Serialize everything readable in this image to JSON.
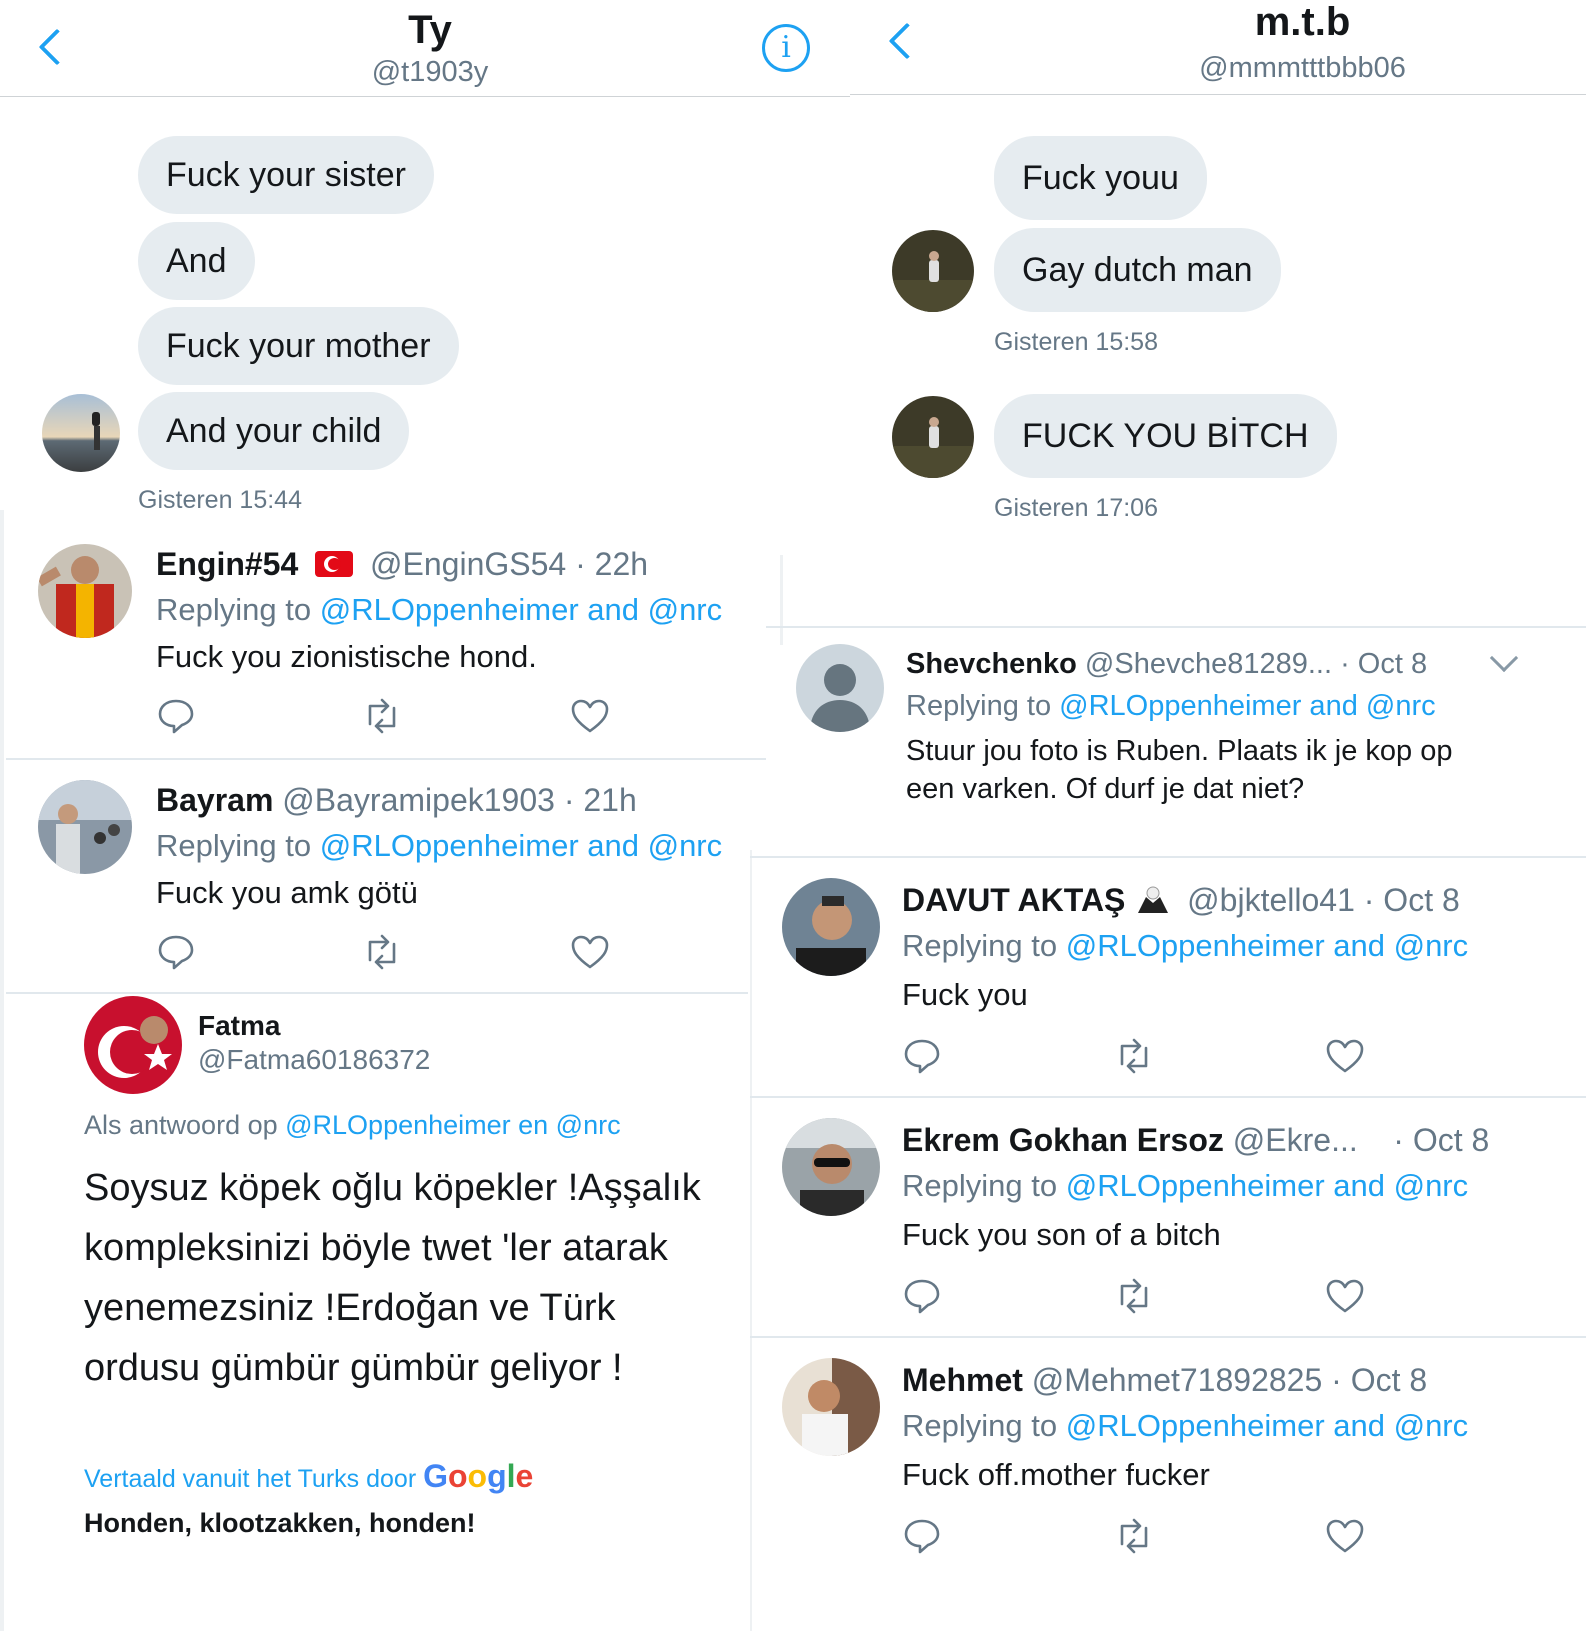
{
  "left_dm": {
    "name": "Ty",
    "handle": "@t1903y",
    "messages": [
      "Fuck your sister",
      "And",
      "Fuck your mother",
      "And your child"
    ],
    "timestamp": "Gisteren 15:44"
  },
  "right_dm": {
    "name": "m.t.b",
    "handle": "@mmmtttbbb06",
    "messages": [
      "Fuck youu",
      "Gay dutch man",
      "FUCK YOU BİTCH"
    ],
    "timestamps": [
      "Gisteren 15:58",
      "Gisteren 17:06"
    ]
  },
  "left_tweets": [
    {
      "name": "Engin#54",
      "flag": "turkish-flag",
      "meta": "@EnginGS54 · 22h",
      "reply_prefix": "Replying to ",
      "reply_targets": "@RLOppenheimer and @nrc",
      "text": "Fuck you zionistische hond."
    },
    {
      "name": "Bayram",
      "meta": "@Bayramipek1903 · 21h",
      "reply_prefix": "Replying to ",
      "reply_targets": "@RLOppenheimer and @nrc",
      "text": "Fuck you amk götü"
    }
  ],
  "fatma": {
    "name": "Fatma",
    "handle": "@Fatma60186372",
    "reply_prefix": "Als antwoord op ",
    "reply_targets": "@RLOppenheimer en @nrc",
    "text_lines": [
      "Soysuz köpek oğlu köpekler !Aşşalık",
      "kompleksinizi böyle twet 'ler atarak",
      "yenemezsiniz !Erdoğan ve Türk",
      "ordusu gümbür gümbür geliyor !"
    ],
    "translated_prefix": "Vertaald vanuit het Turks door ",
    "google": [
      "G",
      "o",
      "o",
      "g",
      "l",
      "e"
    ],
    "translation": "Honden, klootzakken, honden!"
  },
  "right_tweets": [
    {
      "name": "Shevchenko",
      "meta": "@Shevche81289... · Oct 8",
      "reply_prefix": "Replying to ",
      "reply_targets": "@RLOppenheimer and @nrc",
      "text_lines": [
        "Stuur jou foto is Ruben. Plaats ik je kop op",
        "een varken.  Of durf je dat niet?"
      ]
    },
    {
      "name": "DAVUT AKTAŞ",
      "meta": "@bjktello41 · Oct 8",
      "reply_prefix": "Replying to ",
      "reply_targets": "@RLOppenheimer and @nrc",
      "text": "Fuck you"
    },
    {
      "name": "Ekrem Gokhan Ersoz",
      "meta": "@Ekre...    · Oct 8",
      "reply_prefix": "Replying to ",
      "reply_targets": "@RLOppenheimer and @nrc",
      "text": "Fuck you son of a bitch"
    },
    {
      "name": "Mehmet",
      "meta": "@Mehmet71892825 · Oct 8",
      "reply_prefix": "Replying to ",
      "reply_targets": "@RLOppenheimer and @nrc",
      "text": "Fuck off.mother fucker"
    }
  ],
  "colors": {
    "accent": "#1da1f2",
    "bubble": "#e6ecf0",
    "muted": "#657786",
    "text": "#14171a"
  }
}
